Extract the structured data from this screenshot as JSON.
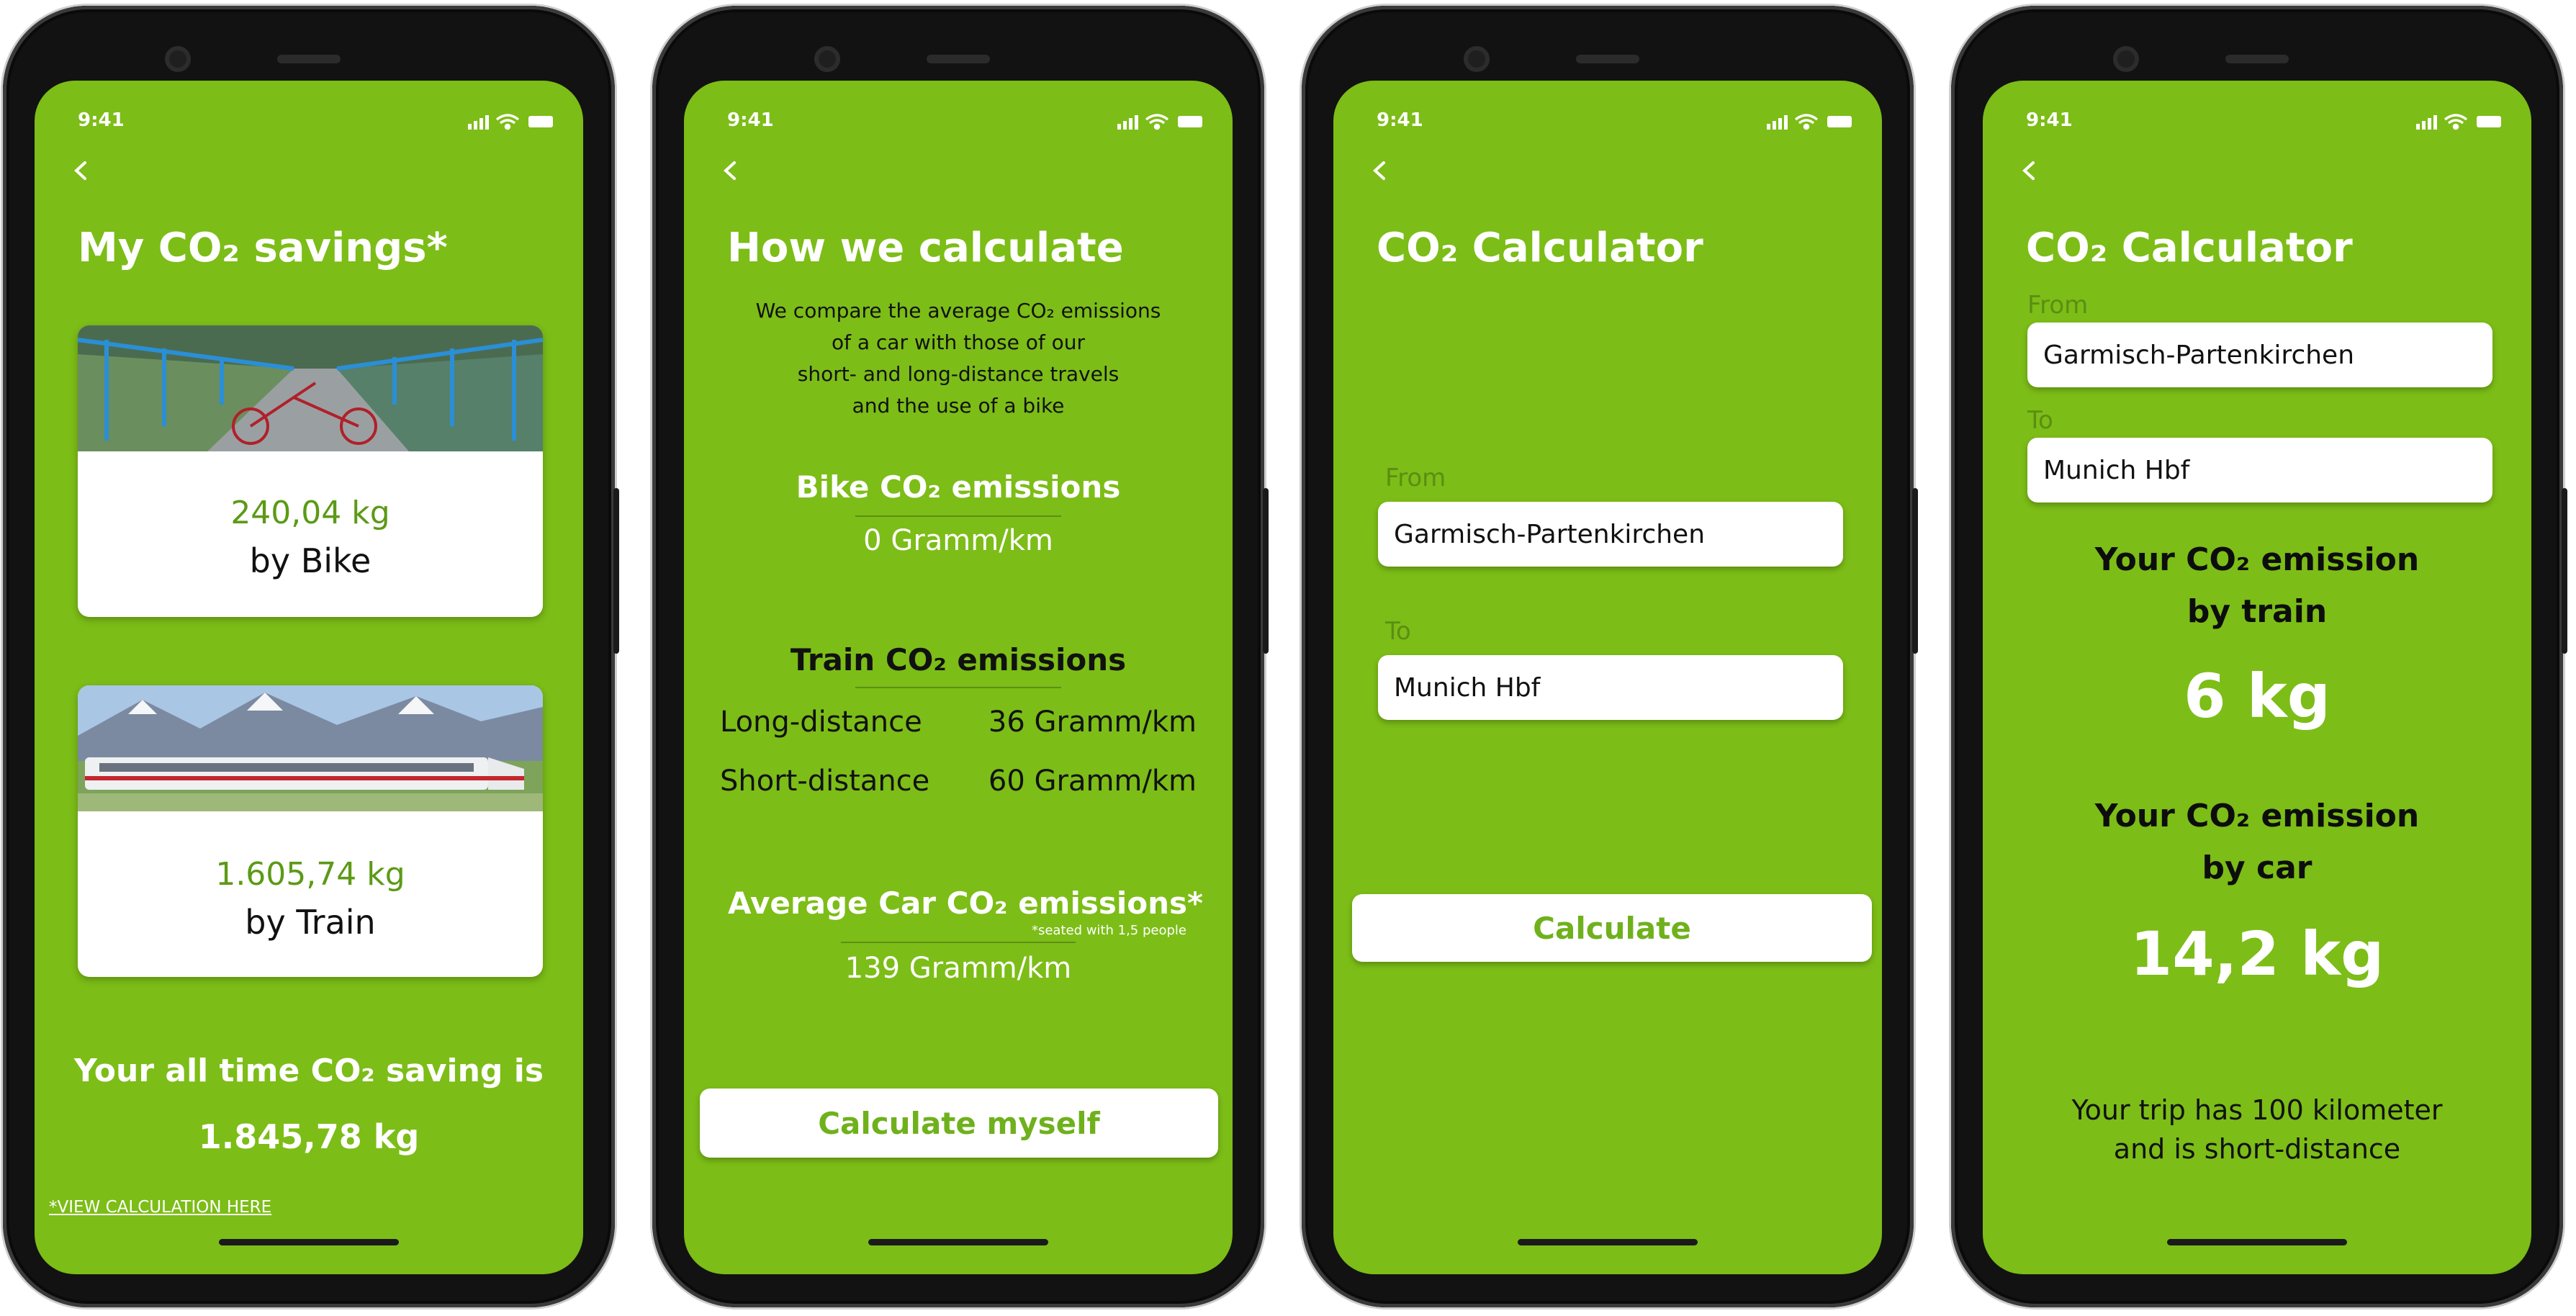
{
  "status": {
    "time": "9:41"
  },
  "screen1": {
    "title": "My CO₂ savings*",
    "bike_value": "240,04 kg",
    "bike_label": "by Bike",
    "train_value": "1.605,74 kg",
    "train_label": "by Train",
    "summary_label": "Your all time CO₂ saving is",
    "summary_value": "1.845,78 kg",
    "footnote_link": "*VIEW CALCULATION HERE"
  },
  "screen2": {
    "title": "How we calculate",
    "intro": [
      "We compare the average CO₂ emissions",
      "of a car with those of our",
      "short- and long-distance travels",
      "and the use of a bike"
    ],
    "bike_title": "Bike CO₂ emissions",
    "bike_value": "0 Gramm/km",
    "train_title": "Train CO₂ emissions",
    "train_rows": [
      {
        "label": "Long-distance",
        "value": "36 Gramm/km"
      },
      {
        "label": "Short-distance",
        "value": "60 Gramm/km"
      }
    ],
    "car_title": "Average Car CO₂ emissions*",
    "car_note": "*seated with 1,5 people",
    "car_value": "139 Gramm/km",
    "button": "Calculate myself"
  },
  "screen3": {
    "title": "CO₂ Calculator",
    "from_label": "From",
    "from_value": "Garmisch-Partenkirchen",
    "to_label": "To",
    "to_value": "Munich Hbf",
    "button": "Calculate"
  },
  "screen4": {
    "title": "CO₂ Calculator",
    "from_label": "From",
    "from_value": "Garmisch-Partenkirchen",
    "to_label": "To",
    "to_value": "Munich Hbf",
    "train_heading_1": "Your CO₂ emission",
    "train_heading_2": "by train",
    "train_value": "6 kg",
    "car_heading_1": "Your CO₂ emission",
    "car_heading_2": "by car",
    "car_value": "14,2 kg",
    "trip_note_1": "Your trip has 100 kilometer",
    "trip_note_2": "and is short-distance"
  },
  "colors": {
    "brand_green": "#7cbd17",
    "value_green": "#5c9a16",
    "button_text": "#6fb11c"
  }
}
